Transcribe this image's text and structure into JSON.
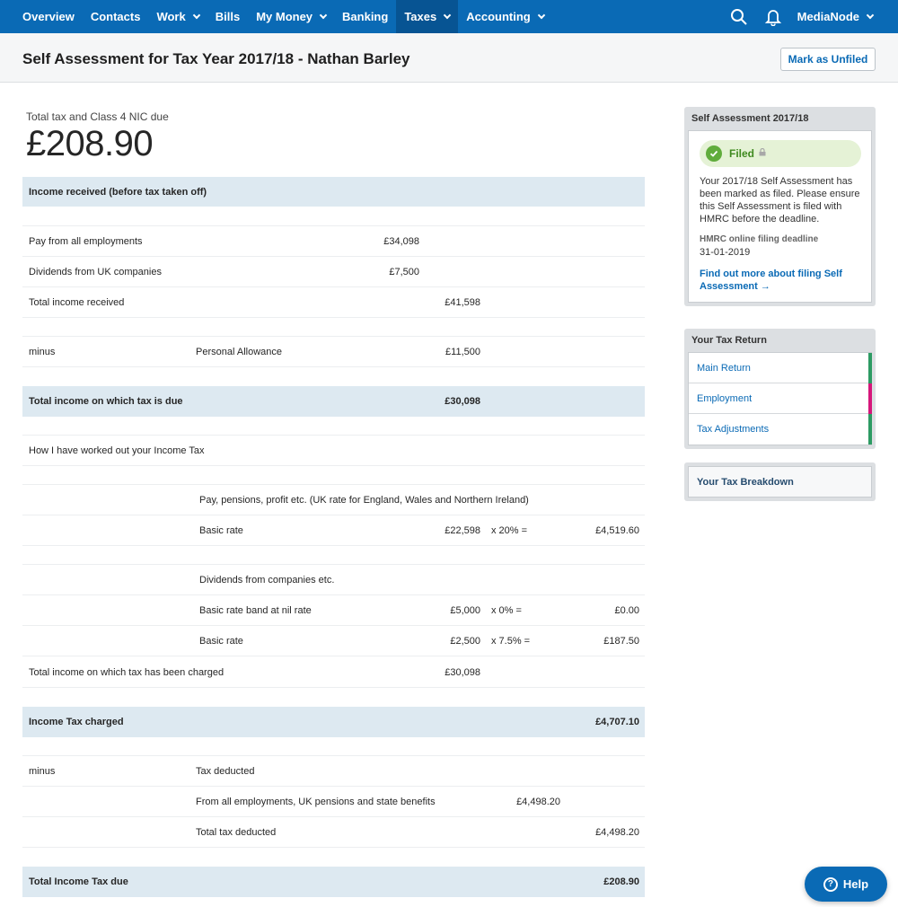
{
  "colors": {
    "nav_bg": "#0a6ab5",
    "nav_active": "#075493",
    "highlight_row": "#dde9f1",
    "filed_green": "#60ac3c",
    "link_blue": "#0a6ab5"
  },
  "nav": {
    "items": [
      "Overview",
      "Contacts",
      "Work",
      "Bills",
      "My Money",
      "Banking",
      "Taxes",
      "Accounting"
    ],
    "org_name": "MediaNode"
  },
  "header": {
    "title": "Self Assessment for Tax Year 2017/18 - Nathan Barley",
    "mark_button": "Mark as Unfiled"
  },
  "summary": {
    "label": "Total tax and Class 4 NIC due",
    "amount": "£208.90"
  },
  "table": {
    "income_header": "Income received (before tax taken off)",
    "pay_label": "Pay from all employments",
    "pay_value": "£34,098",
    "div_label": "Dividends from UK companies",
    "div_value": "£7,500",
    "total_income_label": "Total income received",
    "total_income_value": "£41,598",
    "minus1": "minus",
    "allowance_label": "Personal Allowance",
    "allowance_value": "£11,500",
    "taxable_label": "Total income on which tax is due",
    "taxable_value": "£30,098",
    "worked_label": "How I have worked out your Income Tax",
    "pay_pensions_label": "Pay, pensions, profit etc. (UK rate for England, Wales and Northern Ireland)",
    "basic1_label": "Basic rate",
    "basic1_amount": "£22,598",
    "basic1_rate": "x 20% =",
    "basic1_result": "£4,519.60",
    "dividends_label": "Dividends from companies etc.",
    "nil_label": "Basic rate band at nil rate",
    "nil_amount": "£5,000",
    "nil_rate": "x 0% =",
    "nil_result": "£0.00",
    "basic2_label": "Basic rate",
    "basic2_amount": "£2,500",
    "basic2_rate": "x 7.5% =",
    "basic2_result": "£187.50",
    "charged_label": "Total income on which tax has been charged",
    "charged_value": "£30,098",
    "it_charged_label": "Income Tax charged",
    "it_charged_value": "£4,707.10",
    "minus2": "minus",
    "tax_deducted_label": "Tax deducted",
    "from_emp_label": "From all employments, UK pensions and state benefits",
    "from_emp_value": "£4,498.20",
    "total_deducted_label": "Total tax deducted",
    "total_deducted_value": "£4,498.20",
    "it_due_label": "Total Income Tax due",
    "it_due_value": "£208.90"
  },
  "status_panel": {
    "title": "Self Assessment 2017/18",
    "status": "Filed",
    "message": "Your 2017/18 Self Assessment has been marked as filed. Please ensure this Self Assessment is filed with HMRC before the deadline.",
    "deadline_label": "HMRC online filing deadline",
    "deadline_date": "31-01-2019",
    "link": "Find out more about filing Self Assessment →"
  },
  "return_panel": {
    "title": "Your Tax Return",
    "items": [
      {
        "label": "Main Return",
        "color": "#2d9b63"
      },
      {
        "label": "Employment",
        "color": "#d6177b"
      },
      {
        "label": "Tax Adjustments",
        "color": "#2d9b63"
      }
    ]
  },
  "breakdown": {
    "label": "Your Tax Breakdown"
  },
  "help": {
    "label": "Help"
  }
}
